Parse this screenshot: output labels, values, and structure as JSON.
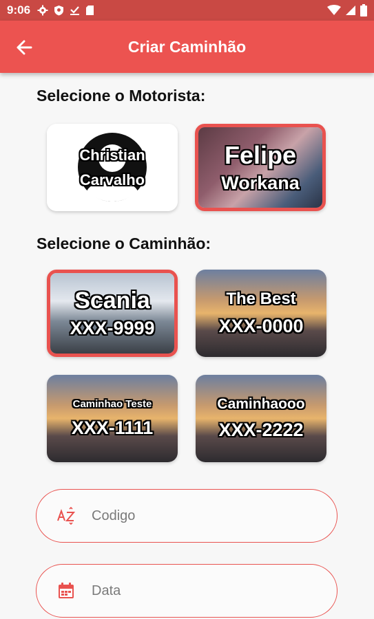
{
  "status_bar": {
    "time": "9:06",
    "icons_left": [
      "gear-icon",
      "shield-icon",
      "download-done-icon",
      "sd-card-icon"
    ],
    "icons_right": [
      "wifi-icon",
      "signal-icon",
      "battery-icon"
    ]
  },
  "app_bar": {
    "title": "Criar Caminhão",
    "background": "#ec5350",
    "back_icon": "arrow-left-icon"
  },
  "drivers_section": {
    "title": "Selecione o Motorista:",
    "drivers": [
      {
        "line1": "Christian",
        "line2": "Carvalho",
        "selected": false,
        "image": "avatar-placeholder"
      },
      {
        "line1": "Felipe",
        "line2": "Workana",
        "selected": true,
        "image": "driver-photo"
      }
    ]
  },
  "trucks_section": {
    "title": "Selecione o Caminhão:",
    "trucks": [
      {
        "name": "Scania",
        "plate": "XXX-9999",
        "selected": true
      },
      {
        "name": "The Best",
        "plate": "XXX-0000",
        "selected": false
      },
      {
        "name": "Caminhao Teste",
        "plate": "XXX-1111",
        "selected": false
      },
      {
        "name": "Caminhaooo",
        "plate": "XXX-2222",
        "selected": false
      }
    ]
  },
  "form": {
    "codigo": {
      "placeholder": "Codigo",
      "value": "",
      "icon": "az-sort-icon"
    },
    "data": {
      "placeholder": "Data",
      "value": "",
      "icon": "calendar-icon"
    }
  },
  "colors": {
    "accent": "#e9524f",
    "status_bar": "#c94944"
  }
}
